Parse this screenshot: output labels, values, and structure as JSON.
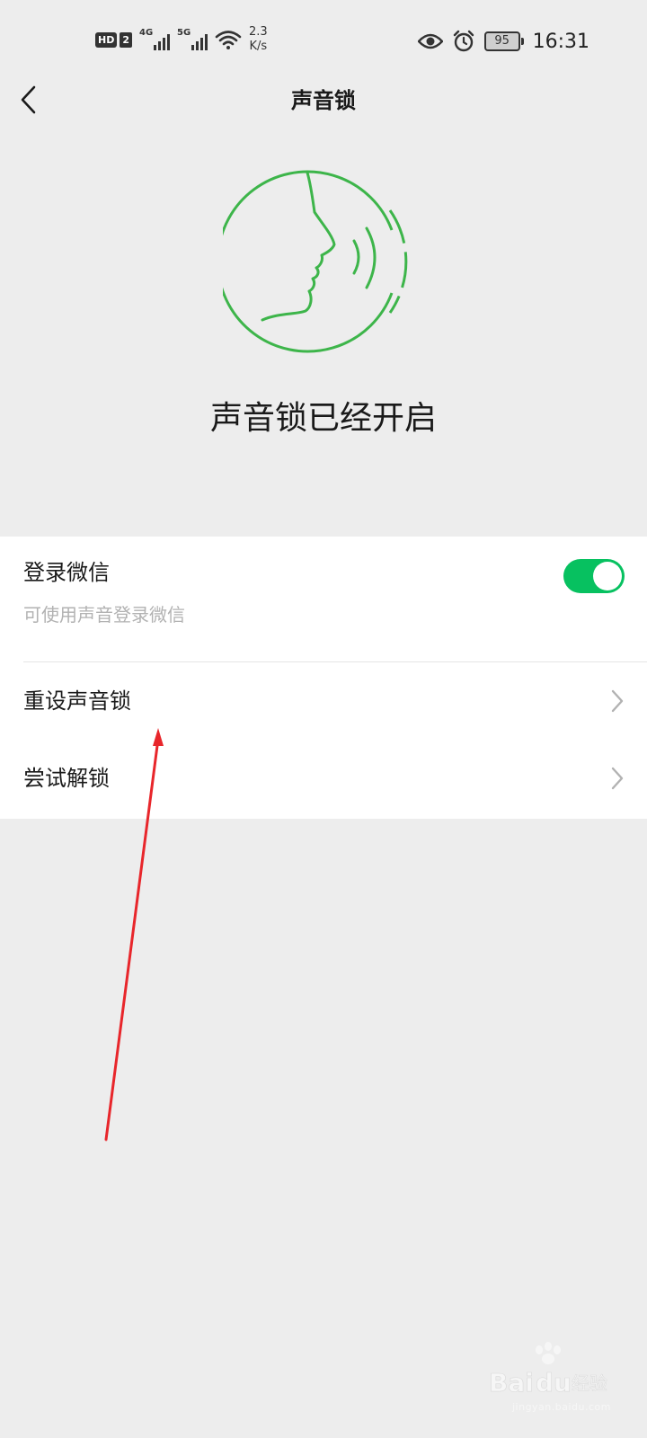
{
  "status_bar": {
    "hd_label": "HD",
    "sim_label": "2",
    "network_1": "4G",
    "network_2": "5G",
    "speed_value": "2.3",
    "speed_unit": "K/s",
    "battery": "95",
    "time": "16:31",
    "icons": [
      "eye-icon",
      "alarm-icon",
      "wifi-icon"
    ]
  },
  "nav": {
    "title": "声音锁",
    "back_icon": "chevron-left-icon"
  },
  "hero": {
    "status_text": "声音锁已经开启",
    "accent_color": "#3db54a"
  },
  "settings": {
    "login_row": {
      "title": "登录微信",
      "subtitle": "可使用声音登录微信",
      "toggle_on": true,
      "toggle_color": "#07c160"
    },
    "reset_row": {
      "title": "重设声音锁"
    },
    "try_row": {
      "title": "尝试解锁"
    }
  },
  "annotation": {
    "arrow_color": "#e8262b"
  },
  "watermark": {
    "brand": "Baidu经验",
    "url": "jingyan.baidu.com"
  }
}
